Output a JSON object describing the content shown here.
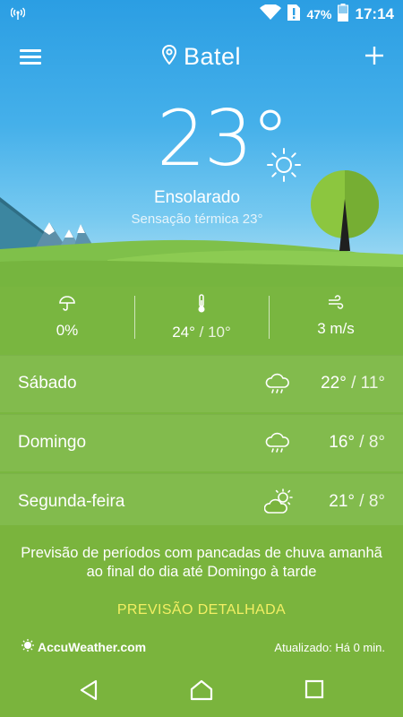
{
  "status_bar": {
    "battery_percent": "47%",
    "time": "17:14",
    "icons": [
      "signal-antenna-icon",
      "wifi-icon",
      "sim-alert-icon",
      "battery-icon"
    ]
  },
  "header": {
    "location": "Batel",
    "icons": [
      "menu-icon",
      "location-pin-icon",
      "add-icon"
    ]
  },
  "current": {
    "temperature": "23°",
    "condition": "Ensolarado",
    "feels_like": "Sensação térmica 23°",
    "icon": "sun-icon"
  },
  "stats": {
    "precipitation": "0%",
    "temp_high": "24°",
    "temp_low": "/ 10°",
    "wind": "3 m/s",
    "icons": [
      "umbrella-icon",
      "thermometer-icon",
      "wind-icon"
    ]
  },
  "forecast": [
    {
      "day": "Sábado",
      "high": "22°",
      "low": "/ 11°",
      "icon": "cloud-rain-icon"
    },
    {
      "day": "Domingo",
      "high": "16°",
      "low": "/ 8°",
      "icon": "cloud-rain-icon"
    },
    {
      "day": "Segunda-feira",
      "high": "21°",
      "low": "/ 8°",
      "icon": "partly-cloudy-icon"
    }
  ],
  "summary": "Previsão de períodos com pancadas de chuva amanhã ao final do dia até Domingo à tarde",
  "detail_button": "PREVISÃO DETALHADA",
  "footer": {
    "brand": "AccuWeather.com",
    "updated": "Atualizado: Há 0 min."
  },
  "colors": {
    "sky_top": "#2b9ee3",
    "grass": "#79b640",
    "accent_yellow": "#f3ef63"
  }
}
